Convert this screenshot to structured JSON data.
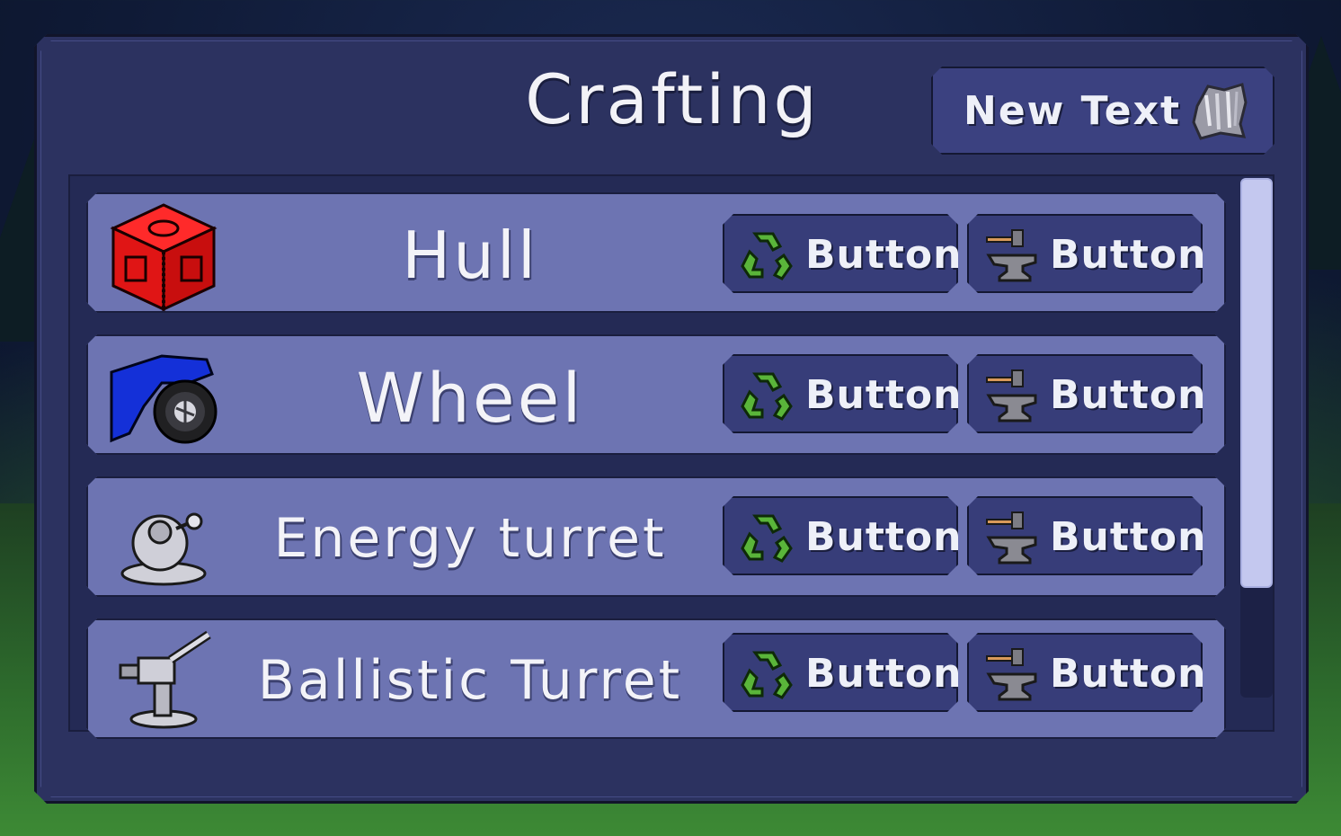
{
  "window": {
    "title": "Crafting",
    "header_button_label": "New Text"
  },
  "rows": [
    {
      "name": "Hull",
      "icon": "hull-block-icon",
      "recycle_label": "Button",
      "craft_label": "Button"
    },
    {
      "name": "Wheel",
      "icon": "wheel-icon",
      "recycle_label": "Button",
      "craft_label": "Button"
    },
    {
      "name": "Energy turret",
      "icon": "energy-turret-icon",
      "recycle_label": "Button",
      "craft_label": "Button"
    },
    {
      "name": "Ballistic Turret",
      "icon": "ballistic-turret-icon",
      "recycle_label": "Button",
      "craft_label": "Button"
    }
  ],
  "icons": {
    "recycle": "recycle-icon",
    "craft": "anvil-hammer-icon",
    "header": "scrap-metal-icon"
  },
  "colors": {
    "panel": "#2c3260",
    "row": "#6d74b2",
    "button": "#373d79",
    "text": "#f3f3f8",
    "recycle_green": "#5ab53a",
    "hull_red": "#e31b1b",
    "wheel_blue": "#1430d8"
  },
  "scrollbar": {
    "position_fraction": 0.0,
    "visible_fraction": 0.79
  }
}
